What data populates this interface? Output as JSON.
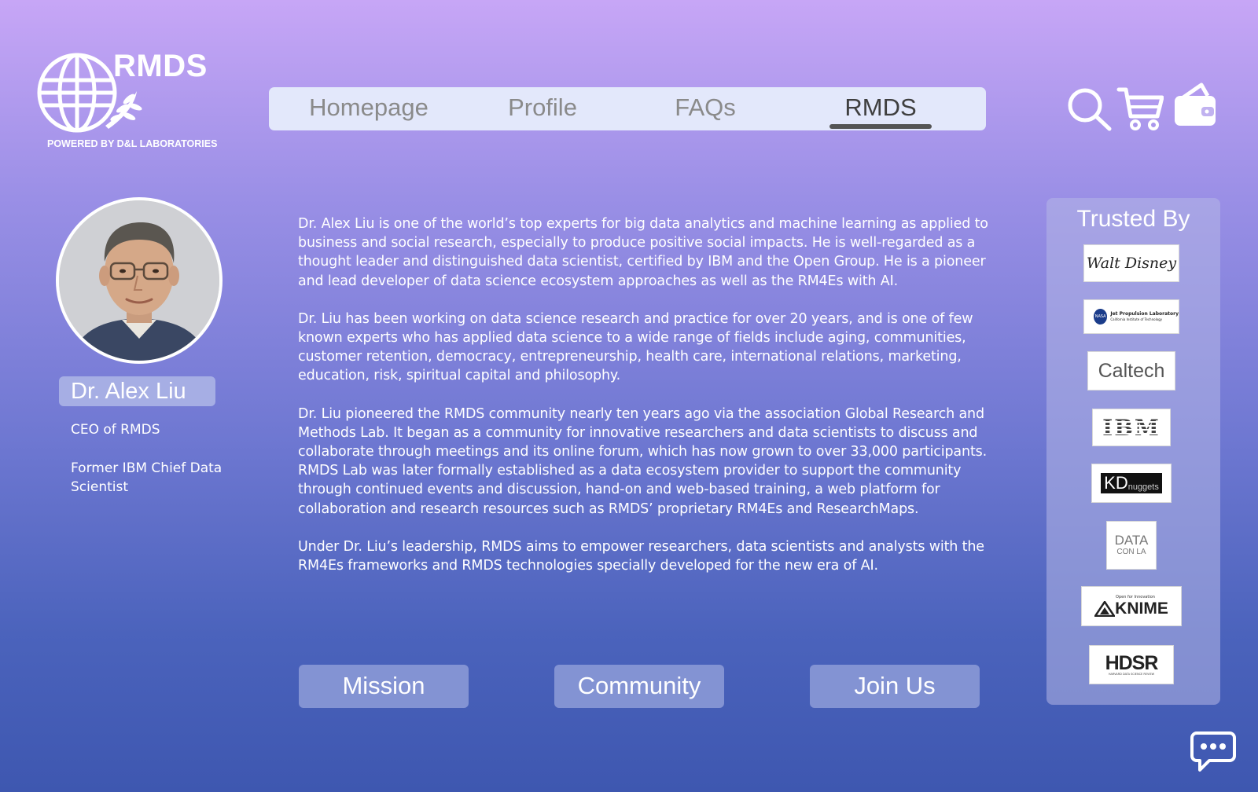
{
  "logo": {
    "brand": "RMDS",
    "tagline": "POWERED BY D&L LABORATORIES"
  },
  "nav": {
    "items": [
      {
        "label": "Homepage"
      },
      {
        "label": "Profile"
      },
      {
        "label": "FAQs"
      },
      {
        "label": "RMDS",
        "active": true
      }
    ]
  },
  "header_icons": [
    "search-icon",
    "cart-icon",
    "wallet-icon"
  ],
  "profile": {
    "name": "Dr. Alex Liu",
    "roles": [
      "CEO of RMDS",
      "Former IBM Chief Data Scientist"
    ]
  },
  "bio": {
    "paragraphs": [
      "Dr. Alex Liu is one of the world’s top experts for big data analytics and machine learning as applied to business and social research, especially to produce positive social impacts. He is well-regarded as a thought leader and distinguished data scientist, certified by IBM and the Open Group. He is a pioneer and lead developer of data science ecosystem approaches as well as the RM4Es with AI.",
      "Dr. Liu has been working on data science research and practice for over 20 years, and is one of few known experts who has applied data science to a wide range of fields include aging, communities, customer retention, democracy, entrepreneurship, health care, international relations, marketing, education, risk, spiritual capital and philosophy.",
      "Dr. Liu pioneered the RMDS community nearly ten years ago via the association Global Research and Methods Lab. It began as a community for innovative researchers and data scientists to discuss and collaborate through meetings and its online forum, which has now grown to over 33,000 participants. RMDS Lab was later formally established as a data ecosystem provider to support the community through continued events and discussion, hand-on and web-based training, a web platform for collaboration and research resources such as RMDS’ proprietary RM4Es and ResearchMaps.",
      "Under Dr. Liu’s leadership, RMDS aims to empower researchers, data scientists and analysts with the RM4Es frameworks and RMDS technologies specially developed for the new era of AI."
    ]
  },
  "actions": {
    "mission": "Mission",
    "community": "Community",
    "join": "Join Us"
  },
  "trusted": {
    "title": "Trusted By",
    "logos": [
      {
        "name": "Walt Disney",
        "text": "Walt Disney"
      },
      {
        "name": "Jet Propulsion Laboratory",
        "text": "Jet Propulsion Laboratory",
        "sub": "California Institute of Technology",
        "badge": "NASA"
      },
      {
        "name": "Caltech",
        "text": "Caltech"
      },
      {
        "name": "IBM",
        "text": "IBM"
      },
      {
        "name": "KDnuggets",
        "text": "KD",
        "sub": "nuggets"
      },
      {
        "name": "Data Con LA",
        "text": "DATA",
        "sub": "CON LA"
      },
      {
        "name": "KNIME",
        "text": "KNIME",
        "sub": "Open for Innovation"
      },
      {
        "name": "HDSR",
        "text": "HDSR",
        "sub": "HARVARD DATA SCIENCE REVIEW"
      }
    ]
  },
  "chat_icon": "chat-icon",
  "colors": {
    "bg_top": "#c7a6f6",
    "bg_bottom": "#3e57b0",
    "nav_bg": "#e3e8fb",
    "button_bg": "#8393d3"
  }
}
